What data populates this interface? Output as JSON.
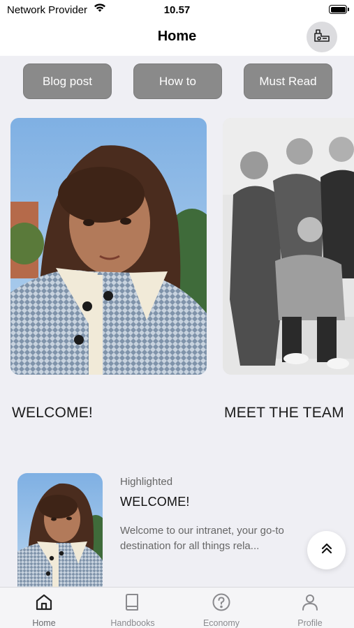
{
  "status_bar": {
    "carrier": "Network Provider",
    "time": "10.57"
  },
  "header": {
    "title": "Home",
    "action_icon": "badge-key-icon"
  },
  "categories": [
    {
      "label": "Blog post"
    },
    {
      "label": "How to"
    },
    {
      "label": "Must Read"
    }
  ],
  "cards": [
    {
      "title": "WELCOME!",
      "image": "girl-portrait-photo"
    },
    {
      "title": "MEET THE TEAM",
      "image": "team-bw-photo"
    }
  ],
  "highlighted": {
    "eyebrow": "Highlighted",
    "title": "WELCOME!",
    "excerpt": "Welcome to our intranet, your go-to destination for all things rela..."
  },
  "tabs": [
    {
      "label": "Home",
      "icon": "home-icon",
      "active": true
    },
    {
      "label": "Handbooks",
      "icon": "book-icon",
      "active": false
    },
    {
      "label": "Economy",
      "icon": "question-circle-icon",
      "active": false
    },
    {
      "label": "Profile",
      "icon": "person-icon",
      "active": false
    }
  ],
  "colors": {
    "background": "#efeff4",
    "chip": "#8a8a8a",
    "tab_inactive": "#8a8a8e"
  }
}
